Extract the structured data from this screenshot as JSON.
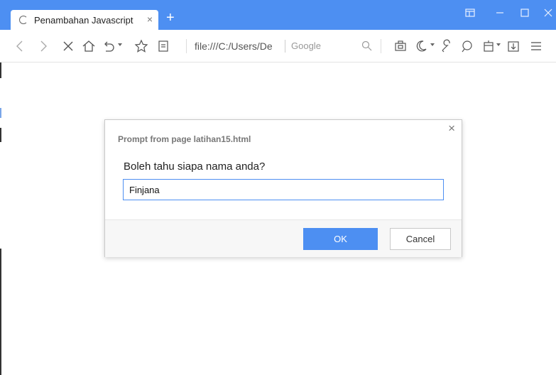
{
  "browser": {
    "tab": {
      "title": "Penambahan Javascript",
      "close_glyph": "×"
    },
    "new_tab_glyph": "+",
    "address_bar": {
      "url": "file:///C:/Users/De"
    },
    "search": {
      "placeholder": "Google"
    },
    "accent_color": "#4d8ff2"
  },
  "dialog": {
    "header": "Prompt from page latihan15.html",
    "close_glyph": "×",
    "message": "Boleh tahu siapa nama anda?",
    "input_value": "Finjana",
    "ok_label": "OK",
    "cancel_label": "Cancel"
  }
}
